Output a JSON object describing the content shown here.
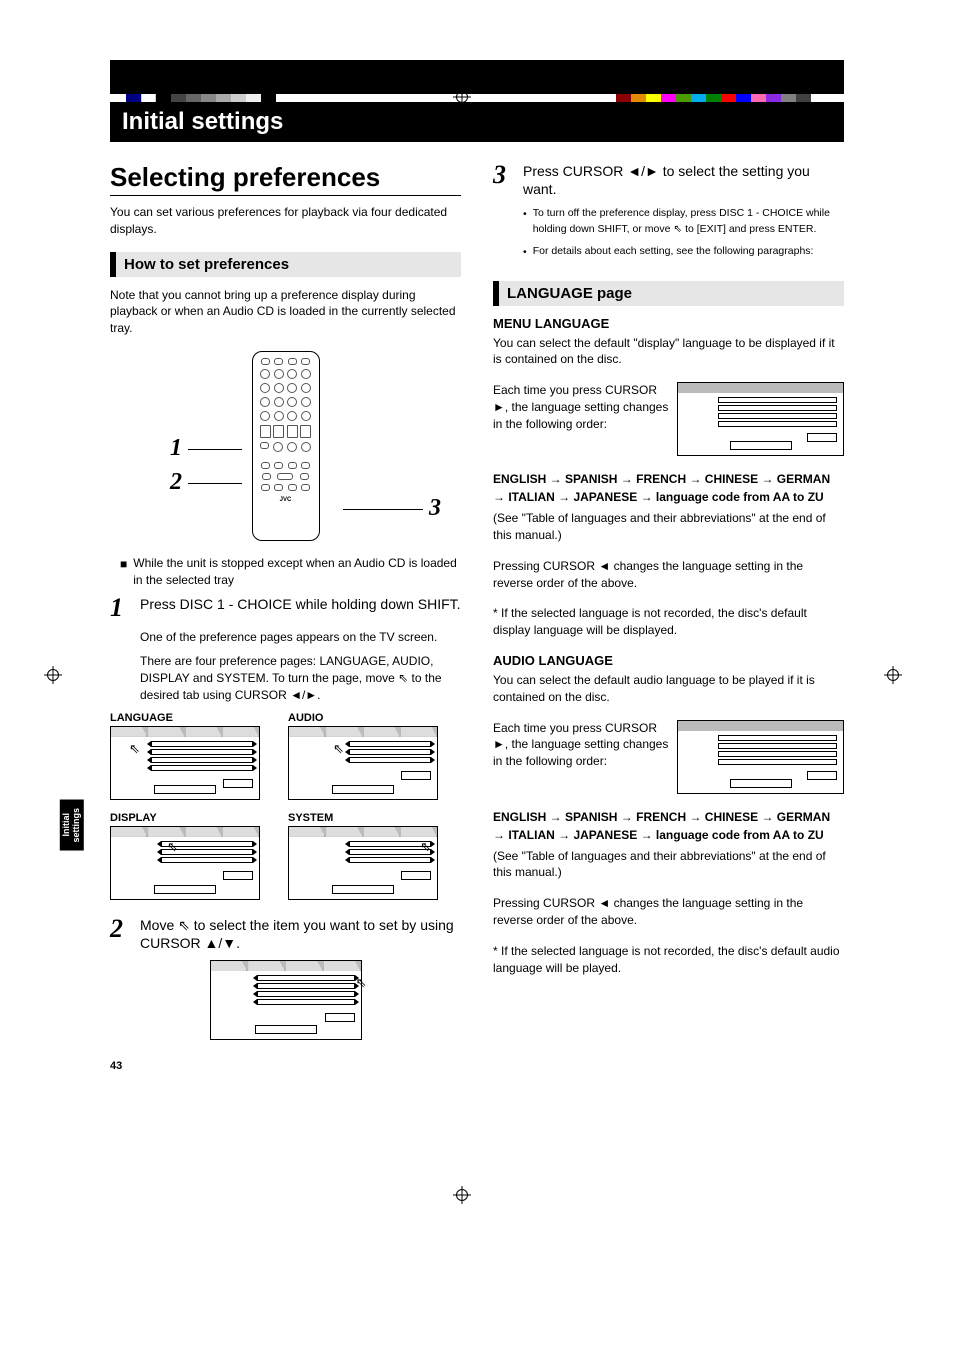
{
  "header": {
    "title": "Initial settings"
  },
  "section": {
    "title": "Selecting preferences",
    "intro": "You can set various preferences for playback via four dedicated displays."
  },
  "howto": {
    "heading": "How to set preferences",
    "note": "Note that you cannot bring up a preference display during playback or when an Audio CD is loaded in the currently selected tray.",
    "remote_labels": {
      "one": "1",
      "two": "2",
      "three": "3"
    },
    "remote_brand": "JVC",
    "bullet_condition": "While the unit is stopped except when an Audio CD is loaded in the selected tray",
    "step1": {
      "num": "1",
      "text": "Press DISC 1 - CHOICE while holding down SHIFT.",
      "sub1": "One of the preference pages appears on the TV screen.",
      "sub2_a": "There are four preference pages: LANGUAGE, AUDIO, DISPLAY and SYSTEM. To turn the page, move ",
      "sub2_b": " to the desired tab using CURSOR ◄/►."
    },
    "pref_pages": {
      "language": "LANGUAGE",
      "audio": "AUDIO",
      "display": "DISPLAY",
      "system": "SYSTEM"
    },
    "step2": {
      "num": "2",
      "text_a": "Move ",
      "text_b": " to select the item you want to set by using CURSOR ▲/▼."
    },
    "step3": {
      "num": "3",
      "text": "Press CURSOR ◄/► to select the setting you want.",
      "bullet1_a": "To turn off the preference display, press DISC 1 - CHOICE while holding down SHIFT, or move ",
      "bullet1_b": " to [EXIT] and press ENTER.",
      "bullet2": "For details about each setting, see the following paragraphs:"
    }
  },
  "language_page": {
    "heading": "LANGUAGE page",
    "menu": {
      "title": "MENU LANGUAGE",
      "desc": "You can select the default \"display\" language to be displayed if it is contained on the disc.",
      "each_time": "Each time you press CURSOR ►, the language setting changes in the following order:",
      "sequence": "ENGLISH → SPANISH → FRENCH → CHINESE → GERMAN → ITALIAN → JAPANESE → language code from AA to ZU",
      "see_table": "(See \"Table of languages and their abbreviations\" at the end of this manual.)",
      "reverse": "Pressing CURSOR ◄ changes the language setting in the reverse order of the above.",
      "asterisk": "* If the selected language is not recorded, the disc's default display language will be displayed."
    },
    "audio": {
      "title": "AUDIO LANGUAGE",
      "desc": "You can select the default audio language to be played if it is contained on the disc.",
      "each_time": "Each time you press CURSOR ►, the language setting changes in the following order:",
      "sequence": "ENGLISH → SPANISH → FRENCH → CHINESE → GERMAN → ITALIAN → JAPANESE → language code from AA to ZU",
      "see_table": "(See \"Table of languages and their abbreviations\" at the end of this manual.)",
      "reverse": "Pressing CURSOR ◄ changes the language setting in the reverse order of the above.",
      "asterisk": "* If the selected language is not recorded, the disc's default audio language will be played."
    }
  },
  "side_tab": "Initial\nsettings",
  "page_number": "43"
}
